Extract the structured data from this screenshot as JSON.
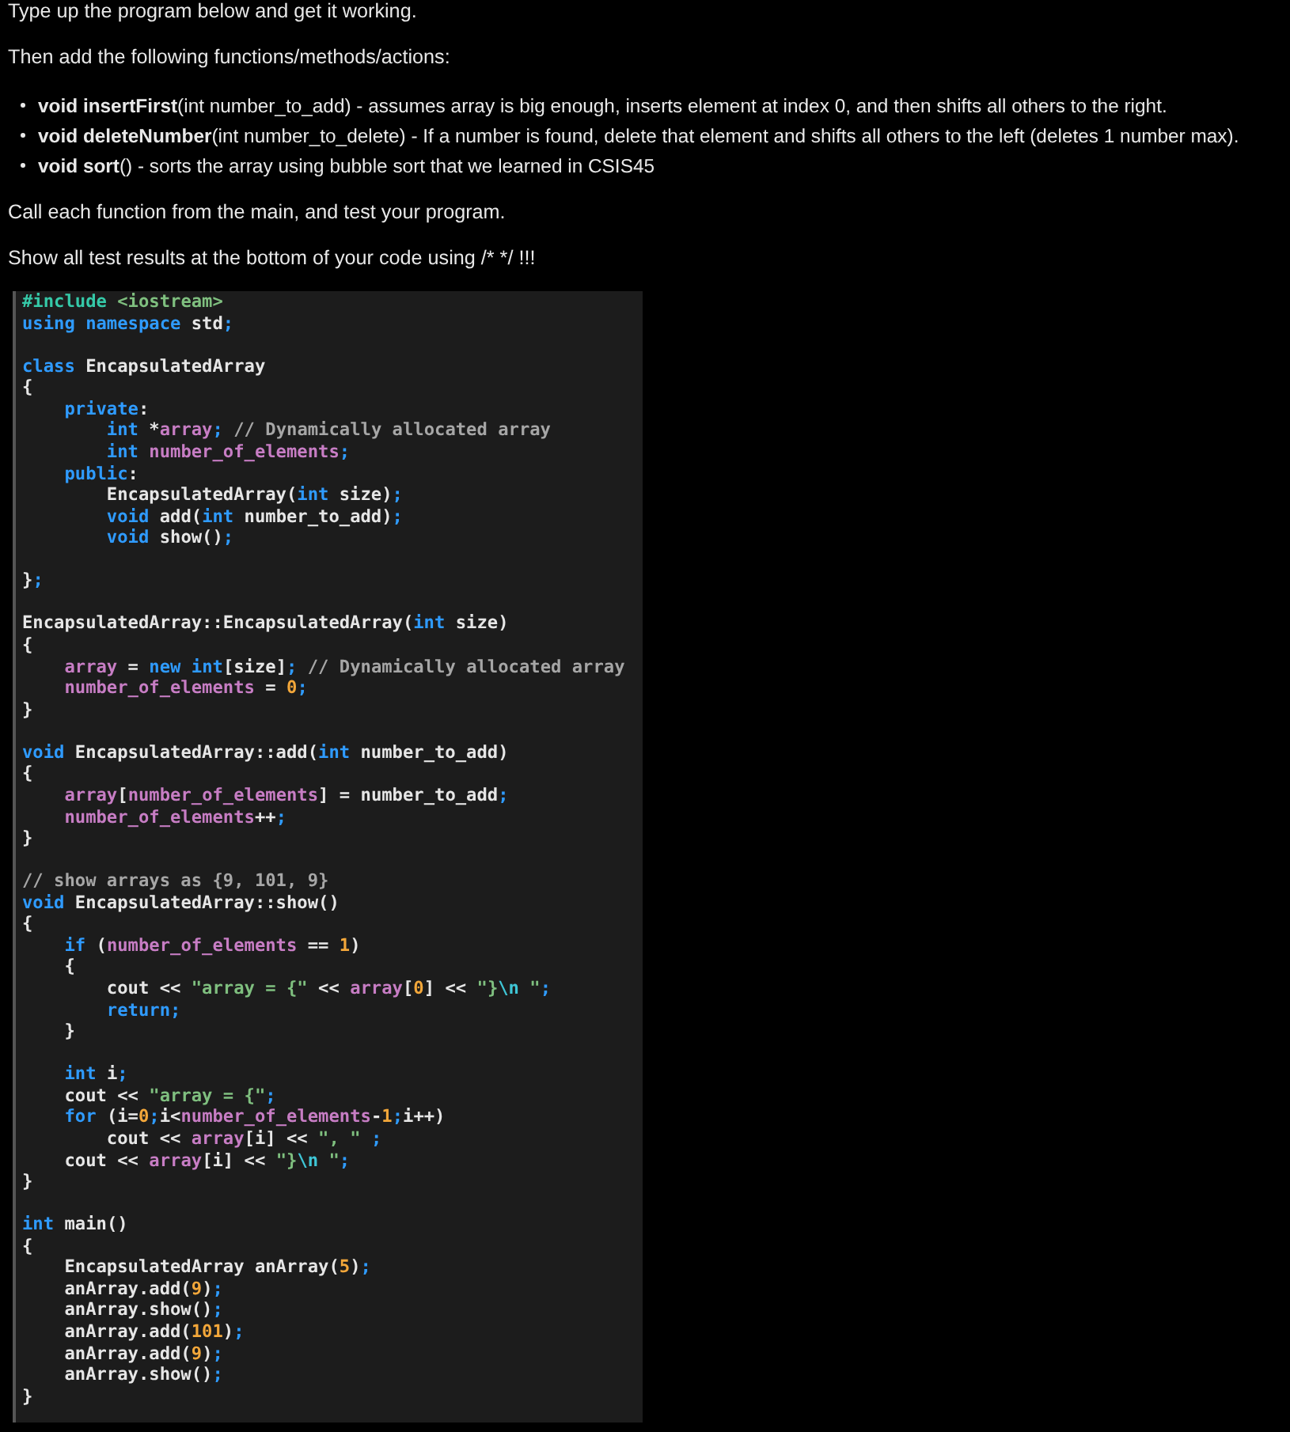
{
  "instructions": {
    "intro": "Type up the program below and get it working.",
    "lead": "Then add the following functions/methods/actions:",
    "bullets": [
      "**void insertFirst**(int number_to_add)  - assumes array is big enough, inserts element at index 0, and then shifts all others to the right.",
      "**void deleteNumber**(int number_to_delete) - If a number is found, delete that element and shifts all others to the left (deletes 1 number max).",
      "**void sort**() - sorts the array using bubble sort that we learned in CSIS45"
    ],
    "call": "Call each function from the main, and test your program.",
    "show": "Show all test results at the bottom of your code using /* */ !!!"
  },
  "code": {
    "lines": [
      {
        "kind": "code",
        "tokens": [
          {
            "kind": "preproc",
            "text": "#include"
          },
          {
            "kind": "string",
            "text": " <iostream>"
          }
        ]
      },
      {
        "kind": "code",
        "tokens": [
          {
            "kind": "keyword",
            "text": "using namespace"
          },
          {
            "kind": "plain",
            "text": " std"
          },
          {
            "kind": "punct",
            "text": ";"
          }
        ]
      },
      {
        "kind": "blank"
      },
      {
        "kind": "code",
        "tokens": [
          {
            "kind": "keyword",
            "text": "class"
          },
          {
            "kind": "plain",
            "text": " EncapsulatedArray"
          }
        ]
      },
      {
        "kind": "code",
        "tokens": [
          {
            "kind": "plain",
            "text": "{"
          }
        ]
      },
      {
        "kind": "code",
        "tokens": [
          {
            "kind": "keyword",
            "text": "    private"
          },
          {
            "kind": "plain",
            "text": ":"
          }
        ]
      },
      {
        "kind": "code",
        "tokens": [
          {
            "kind": "keyword",
            "text": "        int"
          },
          {
            "kind": "plain",
            "text": " *"
          },
          {
            "kind": "member",
            "text": "array"
          },
          {
            "kind": "punct",
            "text": ";"
          },
          {
            "kind": "comment",
            "text": " // Dynamically allocated array"
          }
        ]
      },
      {
        "kind": "code",
        "tokens": [
          {
            "kind": "keyword",
            "text": "        int"
          },
          {
            "kind": "member",
            "text": " number_of_elements"
          },
          {
            "kind": "punct",
            "text": ";"
          }
        ]
      },
      {
        "kind": "code",
        "tokens": [
          {
            "kind": "keyword",
            "text": "    public"
          },
          {
            "kind": "plain",
            "text": ":"
          }
        ]
      },
      {
        "kind": "code",
        "tokens": [
          {
            "kind": "plain",
            "text": "        EncapsulatedArray("
          },
          {
            "kind": "keyword",
            "text": "int"
          },
          {
            "kind": "plain",
            "text": " size)"
          },
          {
            "kind": "punct",
            "text": ";"
          }
        ]
      },
      {
        "kind": "code",
        "tokens": [
          {
            "kind": "keyword",
            "text": "        void"
          },
          {
            "kind": "plain",
            "text": " add("
          },
          {
            "kind": "keyword",
            "text": "int"
          },
          {
            "kind": "plain",
            "text": " number_to_add)"
          },
          {
            "kind": "punct",
            "text": ";"
          }
        ]
      },
      {
        "kind": "code",
        "tokens": [
          {
            "kind": "keyword",
            "text": "        void"
          },
          {
            "kind": "plain",
            "text": " show()"
          },
          {
            "kind": "punct",
            "text": ";"
          }
        ]
      },
      {
        "kind": "blank"
      },
      {
        "kind": "code",
        "tokens": [
          {
            "kind": "plain",
            "text": "}"
          },
          {
            "kind": "punct",
            "text": ";"
          }
        ]
      },
      {
        "kind": "blank"
      },
      {
        "kind": "code",
        "tokens": [
          {
            "kind": "plain",
            "text": "EncapsulatedArray::EncapsulatedArray("
          },
          {
            "kind": "keyword",
            "text": "int"
          },
          {
            "kind": "plain",
            "text": " size)"
          }
        ]
      },
      {
        "kind": "code",
        "tokens": [
          {
            "kind": "plain",
            "text": "{"
          }
        ]
      },
      {
        "kind": "code",
        "tokens": [
          {
            "kind": "member",
            "text": "    array"
          },
          {
            "kind": "plain",
            "text": " = "
          },
          {
            "kind": "keyword",
            "text": "new int"
          },
          {
            "kind": "plain",
            "text": "[size]"
          },
          {
            "kind": "punct",
            "text": ";"
          },
          {
            "kind": "comment",
            "text": " // Dynamically allocated array"
          }
        ]
      },
      {
        "kind": "code",
        "tokens": [
          {
            "kind": "member",
            "text": "    number_of_elements"
          },
          {
            "kind": "plain",
            "text": " = "
          },
          {
            "kind": "number",
            "text": "0"
          },
          {
            "kind": "punct",
            "text": ";"
          }
        ]
      },
      {
        "kind": "code",
        "tokens": [
          {
            "kind": "plain",
            "text": "}"
          }
        ]
      },
      {
        "kind": "blank"
      },
      {
        "kind": "code",
        "tokens": [
          {
            "kind": "keyword",
            "text": "void"
          },
          {
            "kind": "plain",
            "text": " EncapsulatedArray::add("
          },
          {
            "kind": "keyword",
            "text": "int"
          },
          {
            "kind": "plain",
            "text": " number_to_add)"
          }
        ]
      },
      {
        "kind": "code",
        "tokens": [
          {
            "kind": "plain",
            "text": "{"
          }
        ]
      },
      {
        "kind": "code",
        "tokens": [
          {
            "kind": "member",
            "text": "    array"
          },
          {
            "kind": "plain",
            "text": "["
          },
          {
            "kind": "member",
            "text": "number_of_elements"
          },
          {
            "kind": "plain",
            "text": "] = number_to_add"
          },
          {
            "kind": "punct",
            "text": ";"
          }
        ]
      },
      {
        "kind": "code",
        "tokens": [
          {
            "kind": "member",
            "text": "    number_of_elements"
          },
          {
            "kind": "plain",
            "text": "++"
          },
          {
            "kind": "punct",
            "text": ";"
          }
        ]
      },
      {
        "kind": "code",
        "tokens": [
          {
            "kind": "plain",
            "text": "}"
          }
        ]
      },
      {
        "kind": "blank"
      },
      {
        "kind": "code",
        "tokens": [
          {
            "kind": "comment",
            "text": "// show arrays as {9, 101, 9}"
          }
        ]
      },
      {
        "kind": "code",
        "tokens": [
          {
            "kind": "keyword",
            "text": "void"
          },
          {
            "kind": "plain",
            "text": " EncapsulatedArray::show()"
          }
        ]
      },
      {
        "kind": "code",
        "tokens": [
          {
            "kind": "plain",
            "text": "{"
          }
        ]
      },
      {
        "kind": "code",
        "tokens": [
          {
            "kind": "keyword",
            "text": "    if"
          },
          {
            "kind": "plain",
            "text": " ("
          },
          {
            "kind": "member",
            "text": "number_of_elements"
          },
          {
            "kind": "plain",
            "text": " == "
          },
          {
            "kind": "number",
            "text": "1"
          },
          {
            "kind": "plain",
            "text": ")"
          }
        ]
      },
      {
        "kind": "code",
        "tokens": [
          {
            "kind": "plain",
            "text": "    {"
          }
        ]
      },
      {
        "kind": "code",
        "tokens": [
          {
            "kind": "plain",
            "text": "        cout << "
          },
          {
            "kind": "string",
            "text": "\"array = {\""
          },
          {
            "kind": "plain",
            "text": " << "
          },
          {
            "kind": "member",
            "text": "array"
          },
          {
            "kind": "plain",
            "text": "["
          },
          {
            "kind": "number",
            "text": "0"
          },
          {
            "kind": "plain",
            "text": "] << "
          },
          {
            "kind": "string",
            "text": "\"}"
          },
          {
            "kind": "escape",
            "text": "\\n"
          },
          {
            "kind": "string",
            "text": " \""
          },
          {
            "kind": "punct",
            "text": ";"
          }
        ]
      },
      {
        "kind": "code",
        "tokens": [
          {
            "kind": "keyword",
            "text": "        return"
          },
          {
            "kind": "punct",
            "text": ";"
          }
        ]
      },
      {
        "kind": "code",
        "tokens": [
          {
            "kind": "plain",
            "text": "    }"
          }
        ]
      },
      {
        "kind": "blank"
      },
      {
        "kind": "code",
        "tokens": [
          {
            "kind": "keyword",
            "text": "    int"
          },
          {
            "kind": "plain",
            "text": " i"
          },
          {
            "kind": "punct",
            "text": ";"
          }
        ]
      },
      {
        "kind": "code",
        "tokens": [
          {
            "kind": "plain",
            "text": "    cout << "
          },
          {
            "kind": "string",
            "text": "\"array = {\""
          },
          {
            "kind": "punct",
            "text": ";"
          }
        ]
      },
      {
        "kind": "code",
        "tokens": [
          {
            "kind": "keyword",
            "text": "    for"
          },
          {
            "kind": "plain",
            "text": " (i="
          },
          {
            "kind": "number",
            "text": "0"
          },
          {
            "kind": "punct",
            "text": ";"
          },
          {
            "kind": "plain",
            "text": "i<"
          },
          {
            "kind": "member",
            "text": "number_of_elements"
          },
          {
            "kind": "plain",
            "text": "-"
          },
          {
            "kind": "number",
            "text": "1"
          },
          {
            "kind": "punct",
            "text": ";"
          },
          {
            "kind": "plain",
            "text": "i++)"
          }
        ]
      },
      {
        "kind": "code",
        "tokens": [
          {
            "kind": "plain",
            "text": "        cout << "
          },
          {
            "kind": "member",
            "text": "array"
          },
          {
            "kind": "plain",
            "text": "[i] << "
          },
          {
            "kind": "string",
            "text": "\", \""
          },
          {
            "kind": "punct",
            "text": " ;"
          }
        ]
      },
      {
        "kind": "code",
        "tokens": [
          {
            "kind": "plain",
            "text": "    cout << "
          },
          {
            "kind": "member",
            "text": "array"
          },
          {
            "kind": "plain",
            "text": "[i] << "
          },
          {
            "kind": "string",
            "text": "\"}"
          },
          {
            "kind": "escape",
            "text": "\\n"
          },
          {
            "kind": "string",
            "text": " \""
          },
          {
            "kind": "punct",
            "text": ";"
          }
        ]
      },
      {
        "kind": "code",
        "tokens": [
          {
            "kind": "plain",
            "text": "}"
          }
        ]
      },
      {
        "kind": "blank"
      },
      {
        "kind": "code",
        "tokens": [
          {
            "kind": "keyword",
            "text": "int"
          },
          {
            "kind": "plain",
            "text": " main()"
          }
        ]
      },
      {
        "kind": "code",
        "tokens": [
          {
            "kind": "plain",
            "text": "{"
          }
        ]
      },
      {
        "kind": "code",
        "tokens": [
          {
            "kind": "plain",
            "text": "    EncapsulatedArray anArray("
          },
          {
            "kind": "number",
            "text": "5"
          },
          {
            "kind": "plain",
            "text": ")"
          },
          {
            "kind": "punct",
            "text": ";"
          }
        ]
      },
      {
        "kind": "code",
        "tokens": [
          {
            "kind": "plain",
            "text": "    anArray.add("
          },
          {
            "kind": "number",
            "text": "9"
          },
          {
            "kind": "plain",
            "text": ")"
          },
          {
            "kind": "punct",
            "text": ";"
          }
        ]
      },
      {
        "kind": "code",
        "tokens": [
          {
            "kind": "plain",
            "text": "    anArray.show()"
          },
          {
            "kind": "punct",
            "text": ";"
          }
        ]
      },
      {
        "kind": "code",
        "tokens": [
          {
            "kind": "plain",
            "text": "    anArray.add("
          },
          {
            "kind": "number",
            "text": "101"
          },
          {
            "kind": "plain",
            "text": ")"
          },
          {
            "kind": "punct",
            "text": ";"
          }
        ]
      },
      {
        "kind": "code",
        "tokens": [
          {
            "kind": "plain",
            "text": "    anArray.add("
          },
          {
            "kind": "number",
            "text": "9"
          },
          {
            "kind": "plain",
            "text": ")"
          },
          {
            "kind": "punct",
            "text": ";"
          }
        ]
      },
      {
        "kind": "code",
        "tokens": [
          {
            "kind": "plain",
            "text": "    anArray.show()"
          },
          {
            "kind": "punct",
            "text": ";"
          }
        ]
      },
      {
        "kind": "code",
        "tokens": [
          {
            "kind": "plain",
            "text": "}"
          }
        ]
      }
    ]
  }
}
